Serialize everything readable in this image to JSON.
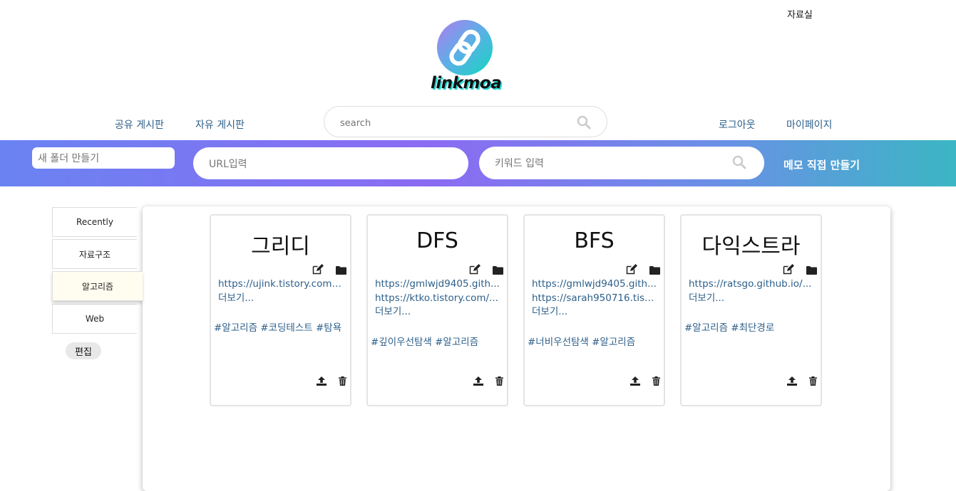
{
  "header": {
    "top_link": "자료실",
    "logo_text": "linkmoa",
    "nav_left": [
      "공유 게시판",
      "자유 게시판"
    ],
    "nav_right": [
      "로그아웃",
      "마이페이지"
    ],
    "search_placeholder": "search"
  },
  "toolbar": {
    "new_folder_placeholder": "새 폴더 만들기",
    "url_placeholder": "URL입력",
    "keyword_placeholder": "키워드 입력",
    "memo_button": "메모 직접 만들기"
  },
  "sidebar": {
    "items": [
      {
        "label": "Recently"
      },
      {
        "label": "자료구조"
      },
      {
        "label": "알고리즘",
        "active": true
      },
      {
        "label": "Web"
      }
    ],
    "edit_button": "편집"
  },
  "cards": [
    {
      "title": "그리디",
      "links": [
        "https://ujink.tistory.com/...",
        "더보기..."
      ],
      "tags": "#알고리즘 #코딩테스트 #탐욕"
    },
    {
      "title": "DFS",
      "links": [
        "https://gmlwjd9405.gith...",
        "https://ktko.tistory.com/...",
        "더보기..."
      ],
      "tags": "#깊이우선탐색 #알고리즘"
    },
    {
      "title": "BFS",
      "links": [
        "https://gmlwjd9405.gith...",
        "https://sarah950716.tist...",
        "더보기..."
      ],
      "tags": "#너비우선탐색 #알고리즘"
    },
    {
      "title": "다익스트라",
      "links": [
        "https://ratsgo.github.io/...",
        "더보기..."
      ],
      "tags": "#알고리즘 #최단경로"
    }
  ],
  "colors": {
    "link": "#2d5f8a",
    "bar_start": "#6a83f2",
    "bar_end": "#3bb6c4",
    "active_tab": "#fffdf0"
  },
  "icons": [
    "search-icon",
    "link-chain-icon",
    "edit-icon",
    "folder-icon",
    "share-upload-icon",
    "trash-icon"
  ]
}
